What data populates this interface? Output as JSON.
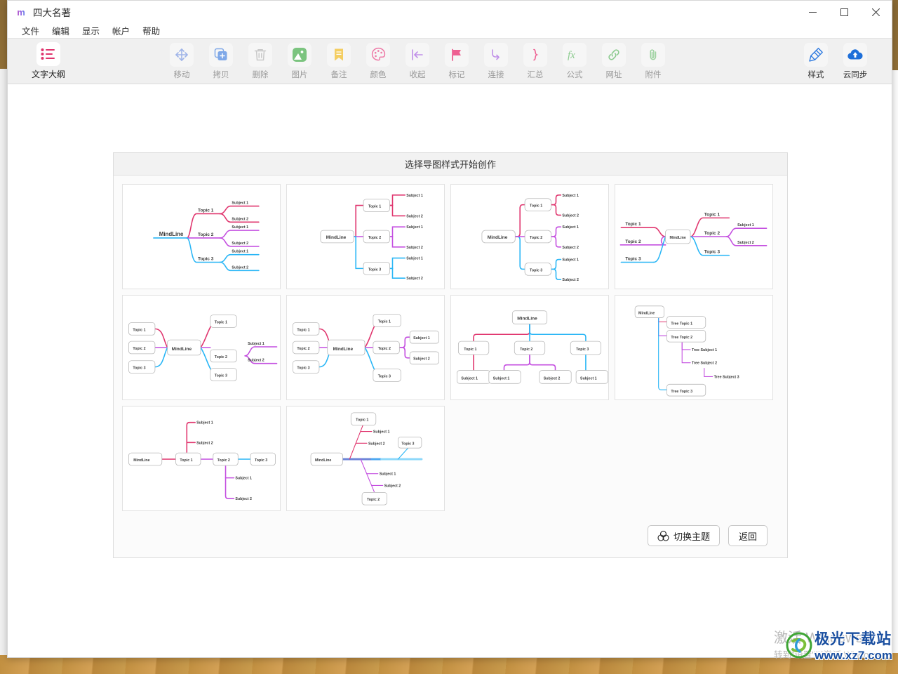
{
  "window": {
    "logo": "m",
    "title": "四大名著",
    "controls": {
      "minimize": "—",
      "maximize": "▢",
      "close": "✕"
    }
  },
  "menu": {
    "items": [
      {
        "label": "文件",
        "name": "menu-file"
      },
      {
        "label": "编辑",
        "name": "menu-edit"
      },
      {
        "label": "显示",
        "name": "menu-view"
      },
      {
        "label": "帐户",
        "name": "menu-account"
      },
      {
        "label": "帮助",
        "name": "menu-help"
      }
    ]
  },
  "toolbar": {
    "outline": {
      "label": "文字大纲",
      "icon": "list-outline-icon"
    },
    "items": [
      {
        "label": "移动",
        "icon": "move-icon"
      },
      {
        "label": "拷贝",
        "icon": "copy-icon"
      },
      {
        "label": "删除",
        "icon": "trash-icon"
      },
      {
        "label": "图片",
        "icon": "image-icon"
      },
      {
        "label": "备注",
        "icon": "note-icon"
      },
      {
        "label": "颜色",
        "icon": "palette-icon"
      },
      {
        "label": "收起",
        "icon": "collapse-icon"
      },
      {
        "label": "标记",
        "icon": "flag-icon"
      },
      {
        "label": "连接",
        "icon": "connect-icon"
      },
      {
        "label": "汇总",
        "icon": "summary-icon"
      },
      {
        "label": "公式",
        "icon": "formula-icon"
      },
      {
        "label": "网址",
        "icon": "link-icon"
      },
      {
        "label": "附件",
        "icon": "attachment-icon"
      }
    ],
    "right": [
      {
        "label": "样式",
        "icon": "style-brush-icon"
      },
      {
        "label": "云同步",
        "icon": "cloud-sync-icon"
      }
    ]
  },
  "dialog": {
    "header": "选择导图样式开始创作",
    "buttons": {
      "switch_theme": "切换主题",
      "switch_theme_icon": "three-circles-icon",
      "back": "返回"
    },
    "templates": [
      {
        "name": "classic-underline-right",
        "root": "MindLine",
        "topics": [
          "Topic 1",
          "Topic 2",
          "Topic 3"
        ],
        "subjects": [
          "Subject 1",
          "Subject 2"
        ]
      },
      {
        "name": "boxed-orthogonal-right",
        "root": "MindLine",
        "topics": [
          "Topic 1",
          "Topic 2",
          "Topic 3"
        ],
        "subjects": [
          "Subject 1",
          "Subject 2"
        ]
      },
      {
        "name": "boxed-bracket-right",
        "root": "MindLine",
        "topics": [
          "Topic 1",
          "Topic 2",
          "Topic 3"
        ],
        "subjects": [
          "Subject 1",
          "Subject 2"
        ]
      },
      {
        "name": "bilateral-underline",
        "root": "MindLine",
        "topics_left": [
          "Topic 1",
          "Topic 2",
          "Topic 3"
        ],
        "topics_right": [
          "Topic 1",
          "Topic 2",
          "Topic 3"
        ],
        "subjects": [
          "Subject 1",
          "Subject 2"
        ]
      },
      {
        "name": "bilateral-boxed",
        "root": "MindLine",
        "topics_left": [
          "Topic 1",
          "Topic 2",
          "Topic 3"
        ],
        "topics_right": [
          "Topic 1",
          "Topic 2",
          "Topic 3"
        ],
        "subjects": [
          "Subject 1",
          "Subject 2"
        ]
      },
      {
        "name": "bilateral-boxed-subjects",
        "root": "MindLine",
        "topics_left": [
          "Topic 1",
          "Topic 2",
          "Topic 3"
        ],
        "topics_right": [
          "Topic 1",
          "Topic 2",
          "Topic 3"
        ],
        "subjects": [
          "Subject 1",
          "Subject 2"
        ]
      },
      {
        "name": "org-chart-top-down",
        "root": "MindLine",
        "topics": [
          "Topic 1",
          "Topic 2",
          "Topic 3"
        ],
        "subjects": [
          "Subject 1",
          "Subject 1",
          "Subject 2",
          "Subject 1"
        ]
      },
      {
        "name": "tree-outline",
        "root": "MindLine",
        "topics": [
          "Tree Topic 1",
          "Tree Topic 2",
          "Tree Topic 3"
        ],
        "subjects": [
          "Tree Subject 1",
          "Tree Subject 2",
          "Tree Subject 3"
        ]
      },
      {
        "name": "timeline-horizontal",
        "root": "MindLine",
        "topics": [
          "Topic 1",
          "Topic 2",
          "Topic 3"
        ],
        "subjects": [
          "Subject 1",
          "Subject 2"
        ]
      },
      {
        "name": "fishbone",
        "root": "MindLine",
        "topics": [
          "Topic 1",
          "Topic 2",
          "Topic 3"
        ],
        "subjects": [
          "Subject 1",
          "Subject 2"
        ]
      }
    ],
    "node_labels": {
      "root": "MindLine",
      "topic1": "Topic 1",
      "topic2": "Topic 2",
      "topic3": "Topic 3",
      "subject1": "Subject 1",
      "subject2": "Subject 2",
      "tree_topic1": "Tree Topic 1",
      "tree_topic2": "Tree Topic 2",
      "tree_topic3": "Tree Topic 3",
      "tree_subject1": "Tree Subject 1",
      "tree_subject2": "Tree Subject 2",
      "tree_subject3": "Tree Subject 3"
    }
  },
  "colors": {
    "branch_pink": "#E0356E",
    "branch_purple": "#C44FE0",
    "branch_cyan": "#29B6F6",
    "annotation_arrow": "#FF1A0E",
    "accent_blue": "#1A4FA0"
  },
  "watermarks": {
    "windows_activate_line1": "激活 Windows",
    "windows_activate_line2": "转到\"设置\"以激活 Windows。",
    "site_name": "极光下载站",
    "site_url": "www.xz7.com"
  }
}
